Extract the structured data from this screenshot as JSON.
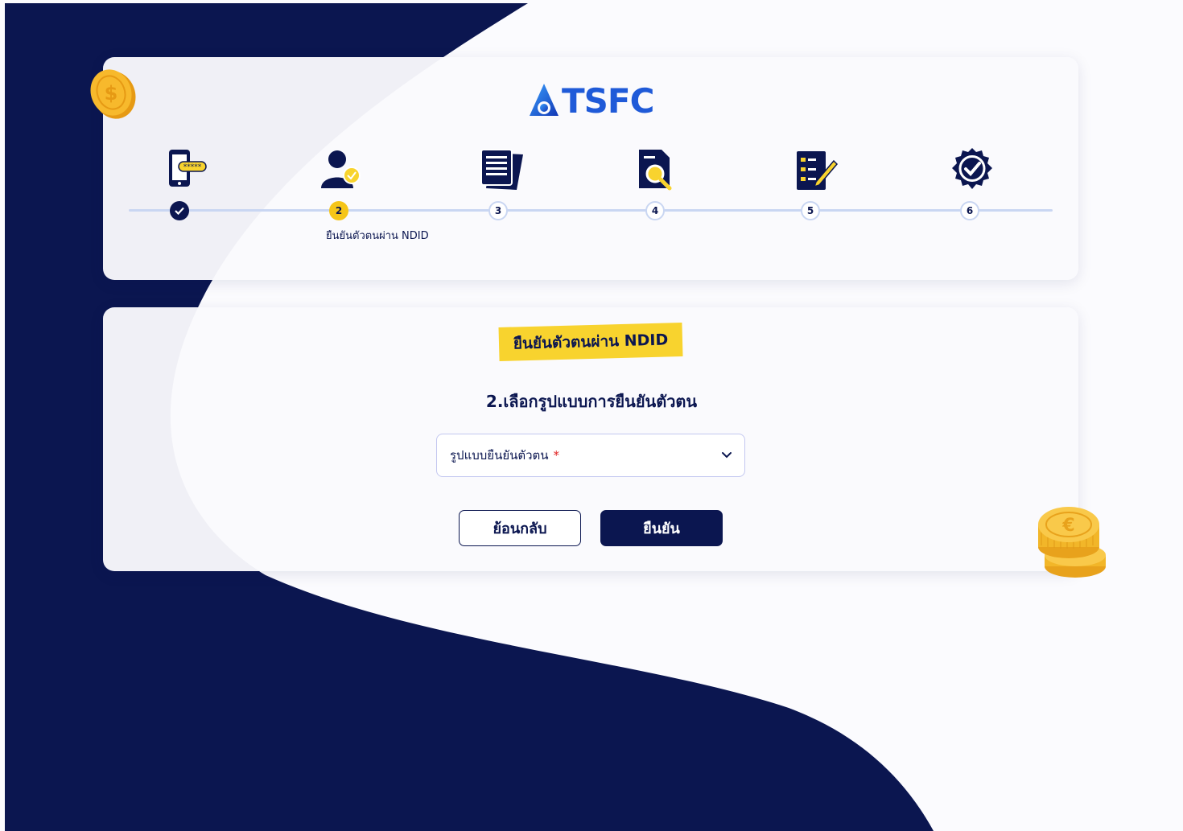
{
  "brand": {
    "logo_text": "TSFC",
    "logo_color": "#1f5ad8"
  },
  "colors": {
    "navy": "#0b1650",
    "accent_yellow": "#f5c518",
    "tag_yellow": "#f8d32e",
    "line": "#c9d6f2",
    "required": "#e02424"
  },
  "stepper": {
    "steps": [
      {
        "icon": "phone-otp-icon",
        "status": "done",
        "label": ""
      },
      {
        "icon": "user-verify-icon",
        "status": "active",
        "label": "2"
      },
      {
        "icon": "documents-icon",
        "status": "pending",
        "label": "3"
      },
      {
        "icon": "document-search-icon",
        "status": "pending",
        "label": "4"
      },
      {
        "icon": "checklist-sign-icon",
        "status": "pending",
        "label": "5"
      },
      {
        "icon": "verified-badge-icon",
        "status": "pending",
        "label": "6"
      }
    ],
    "active_caption": "ยืนยันตัวตนผ่าน NDID"
  },
  "form": {
    "section_tag": "ยืนยันตัวตนผ่าน NDID",
    "subtitle": "2.เลือกรูปแบบการยืนยันตัวตน",
    "select_label": "รูปแบบยืนยันตัวตน",
    "required_mark": "*",
    "back_button": "ย้อนกลับ",
    "confirm_button": "ยืนยัน"
  },
  "decorations": [
    "dollar-coin-icon",
    "euro-coin-stack-icon"
  ]
}
